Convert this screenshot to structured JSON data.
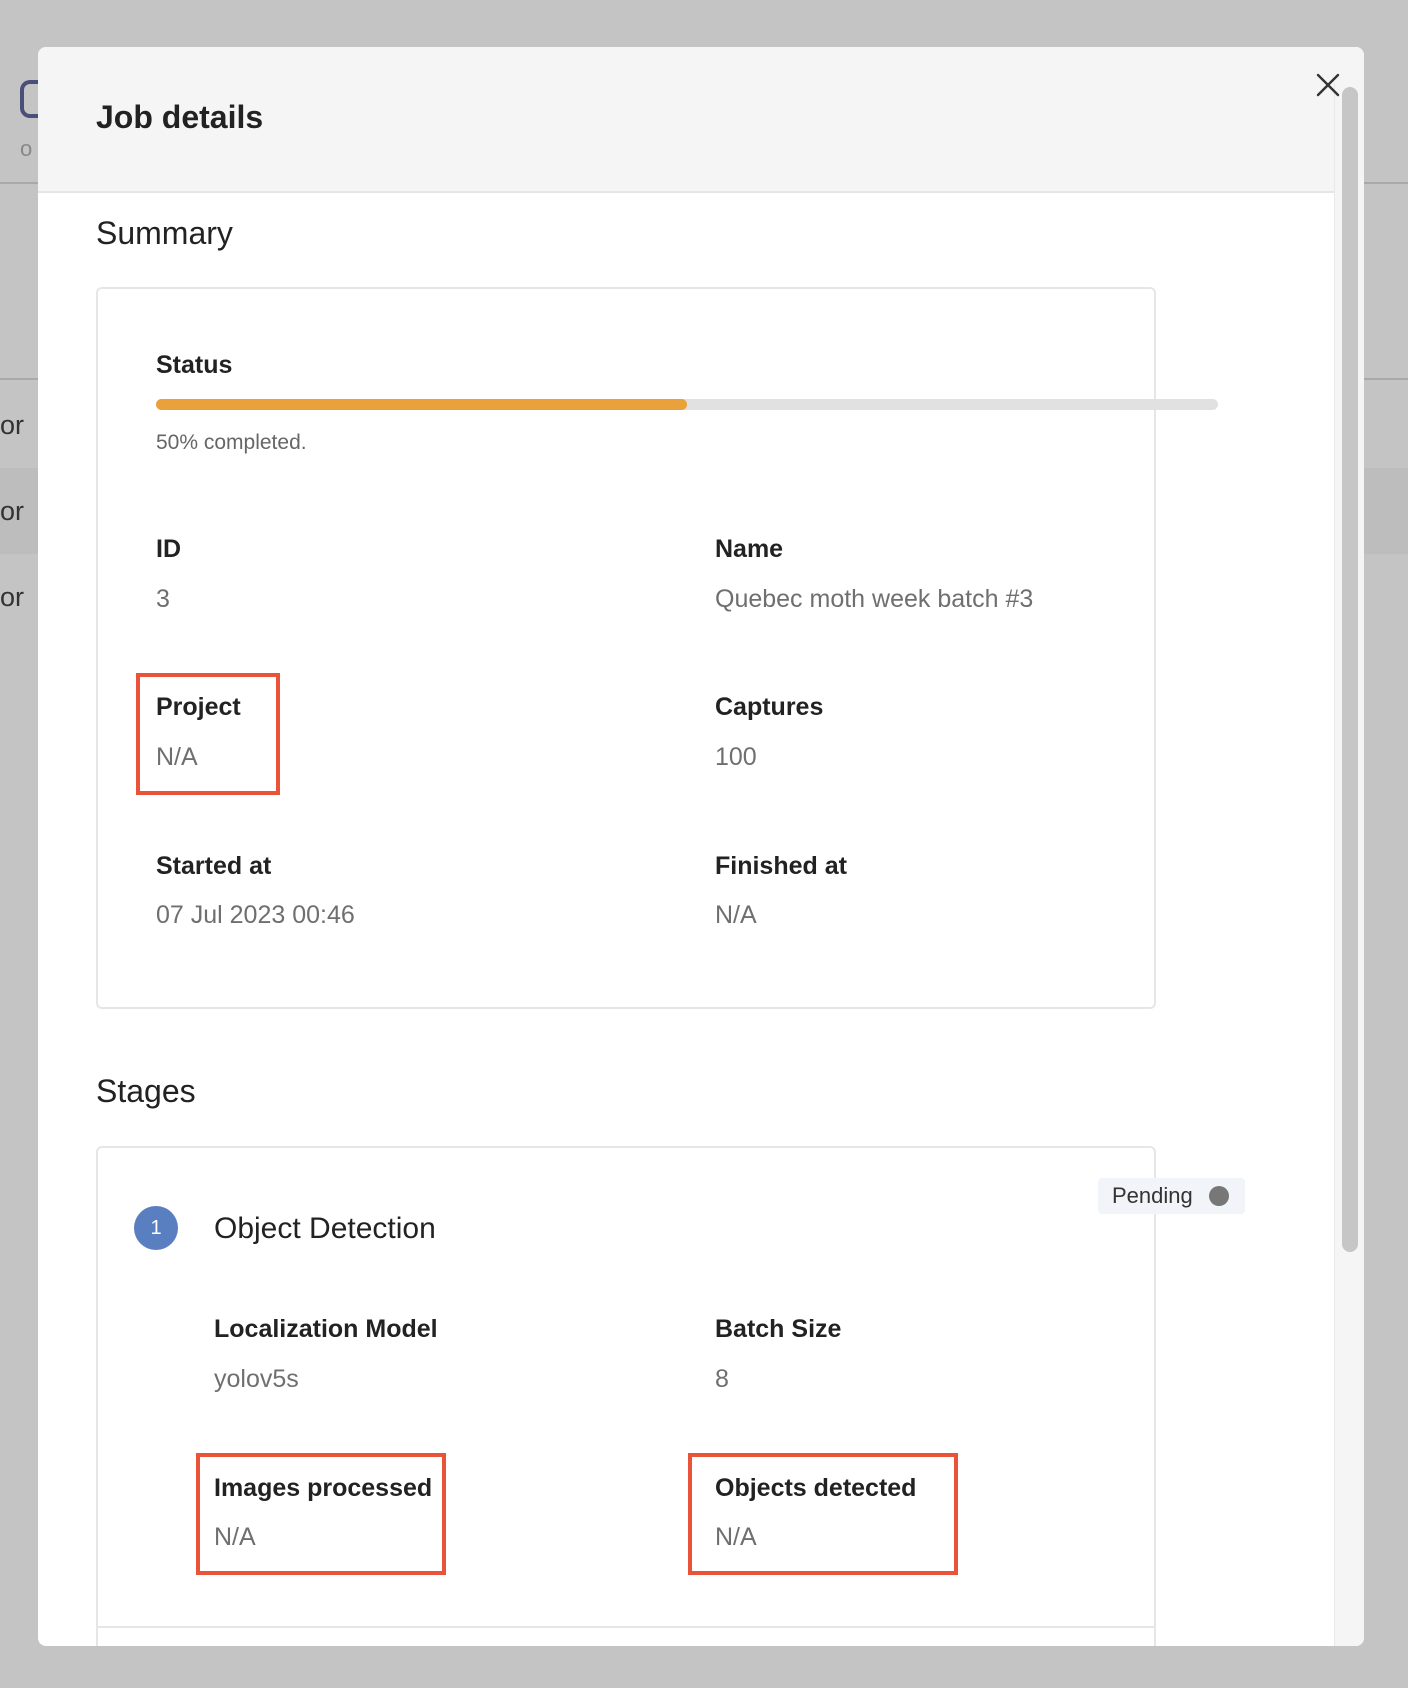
{
  "background": {
    "partial_letter": "o",
    "rows": [
      "or",
      "or",
      "or"
    ]
  },
  "modal": {
    "title": "Job details",
    "close_icon": "close-icon"
  },
  "summary": {
    "section_title": "Summary",
    "status": {
      "label": "Status",
      "progress_percent": 50,
      "progress_text": "50% completed."
    },
    "fields": {
      "id_label": "ID",
      "id_value": "3",
      "name_label": "Name",
      "name_value": "Quebec moth week batch #3",
      "project_label": "Project",
      "project_value": "N/A",
      "captures_label": "Captures",
      "captures_value": "100",
      "started_label": "Started at",
      "started_value": "07 Jul 2023 00:46",
      "finished_label": "Finished at",
      "finished_value": "N/A"
    }
  },
  "stages": {
    "section_title": "Stages",
    "items": [
      {
        "number": "1",
        "name": "Object Detection",
        "status": "Pending",
        "localization_label": "Localization Model",
        "localization_value": "yolov5s",
        "batch_label": "Batch Size",
        "batch_value": "8",
        "images_label": "Images processed",
        "images_value": "N/A",
        "objects_label": "Objects detected",
        "objects_value": "N/A"
      }
    ]
  },
  "colors": {
    "progress": "#e9a23b",
    "highlight": "#e8533a",
    "stage_badge": "#5a7fc1",
    "status_dot": "#777777"
  }
}
